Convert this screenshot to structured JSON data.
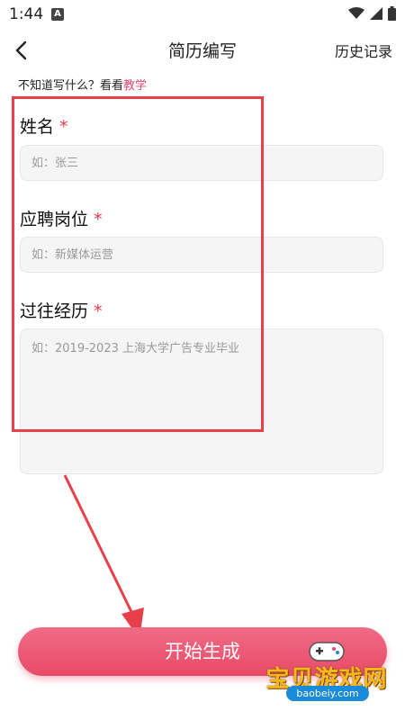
{
  "status_bar": {
    "time": "1:44",
    "app_badge": "A"
  },
  "header": {
    "title": "简历编写",
    "history_label": "历史记录"
  },
  "hint": {
    "prefix": "不知道写什么？看看",
    "link": "教学"
  },
  "form": {
    "name": {
      "label": "姓名",
      "required_mark": "*",
      "placeholder": "如：张三"
    },
    "position": {
      "label": "应聘岗位",
      "required_mark": "*",
      "placeholder": "如：新媒体运营"
    },
    "experience": {
      "label": "过往经历",
      "required_mark": "*",
      "placeholder": "如：2019-2023 上海大学广告专业毕业"
    }
  },
  "start_button": {
    "label": "开始生成"
  },
  "watermark": {
    "text": "宝贝游戏网",
    "url": "baobeiy.com"
  },
  "colors": {
    "accent": "#e8486a",
    "highlight_box": "#e8404a",
    "input_bg": "#f5f5f5"
  },
  "icons": [
    "back-arrow-icon",
    "wifi-icon",
    "signal-icon",
    "battery-icon",
    "gamepad-icon"
  ]
}
